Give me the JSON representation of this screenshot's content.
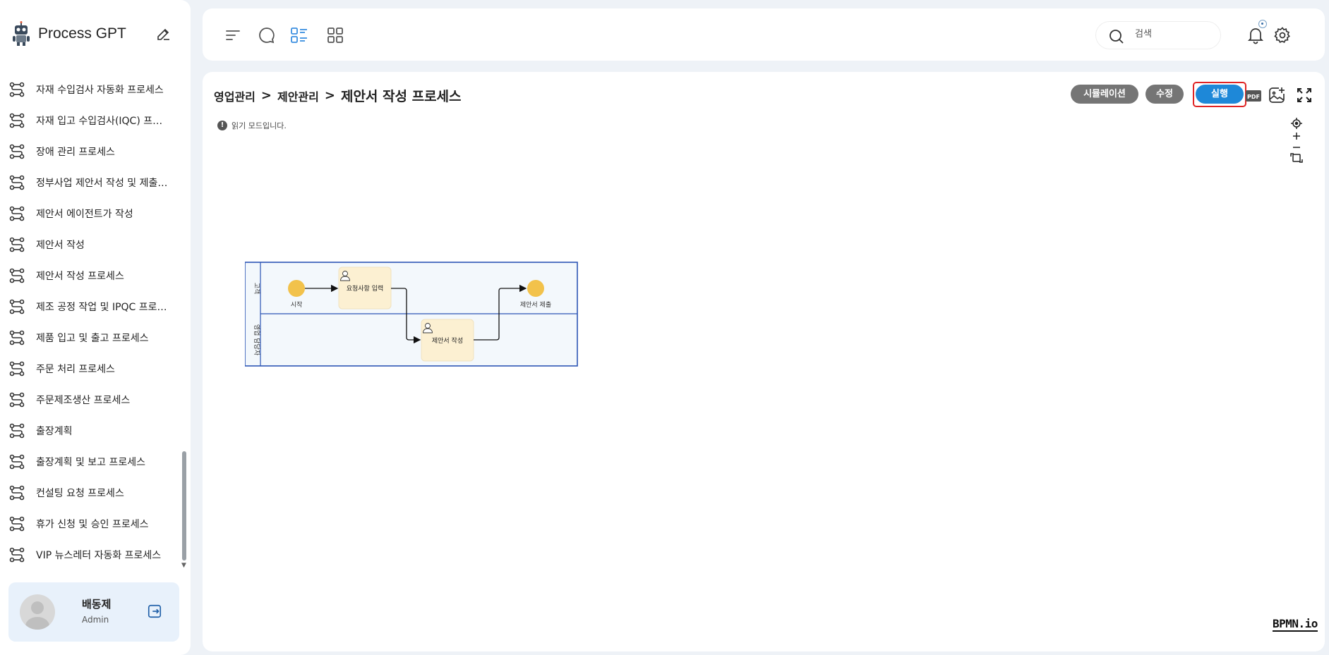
{
  "app": {
    "title": "Process GPT"
  },
  "sidebar": {
    "items": [
      {
        "label": "자재 수입검사 자동화 프로세스"
      },
      {
        "label": "자재 입고 수입검사(IQC) 프로세스"
      },
      {
        "label": "장애 관리 프로세스"
      },
      {
        "label": "정부사업 제안서 작성 및 제출 프로세스"
      },
      {
        "label": "제안서 에이전트가 작성"
      },
      {
        "label": "제안서 작성"
      },
      {
        "label": "제안서 작성 프로세스"
      },
      {
        "label": "제조 공정 작업 및 IPQC 프로세스"
      },
      {
        "label": "제품 입고 및 출고 프로세스"
      },
      {
        "label": "주문 처리 프로세스"
      },
      {
        "label": "주문제조생산 프로세스"
      },
      {
        "label": "출장계획"
      },
      {
        "label": "출장계획 및 보고 프로세스"
      },
      {
        "label": "컨설팅 요청 프로세스"
      },
      {
        "label": "휴가 신청 및 승인 프로세스"
      },
      {
        "label": "VIP 뉴스레터 자동화 프로세스"
      }
    ],
    "user": {
      "name": "배동제",
      "role": "Admin"
    }
  },
  "topbar": {
    "search": {
      "placeholder": "검색"
    }
  },
  "main": {
    "breadcrumb": [
      "영업관리",
      "제안관리",
      "제안서 작성 프로세스"
    ],
    "buttons": {
      "simulation": "시뮬레이션",
      "edit": "수정",
      "run": "실행"
    },
    "pdf_label": "PDF",
    "read_mode": "읽기 모드입니다.",
    "read_mode_icon": "!",
    "watermark": "BPMN.io"
  },
  "diagram": {
    "lanes": [
      "고객",
      "영업 담당자"
    ],
    "start_event": "시작",
    "tasks": [
      "요청사항 입력",
      "제안서 작성"
    ],
    "end_event": "제안서 제출"
  },
  "colors": {
    "accent": "#1e88d8",
    "highlight": "#e02424",
    "event": "#f2c24b",
    "task": "#fcf0d2"
  }
}
